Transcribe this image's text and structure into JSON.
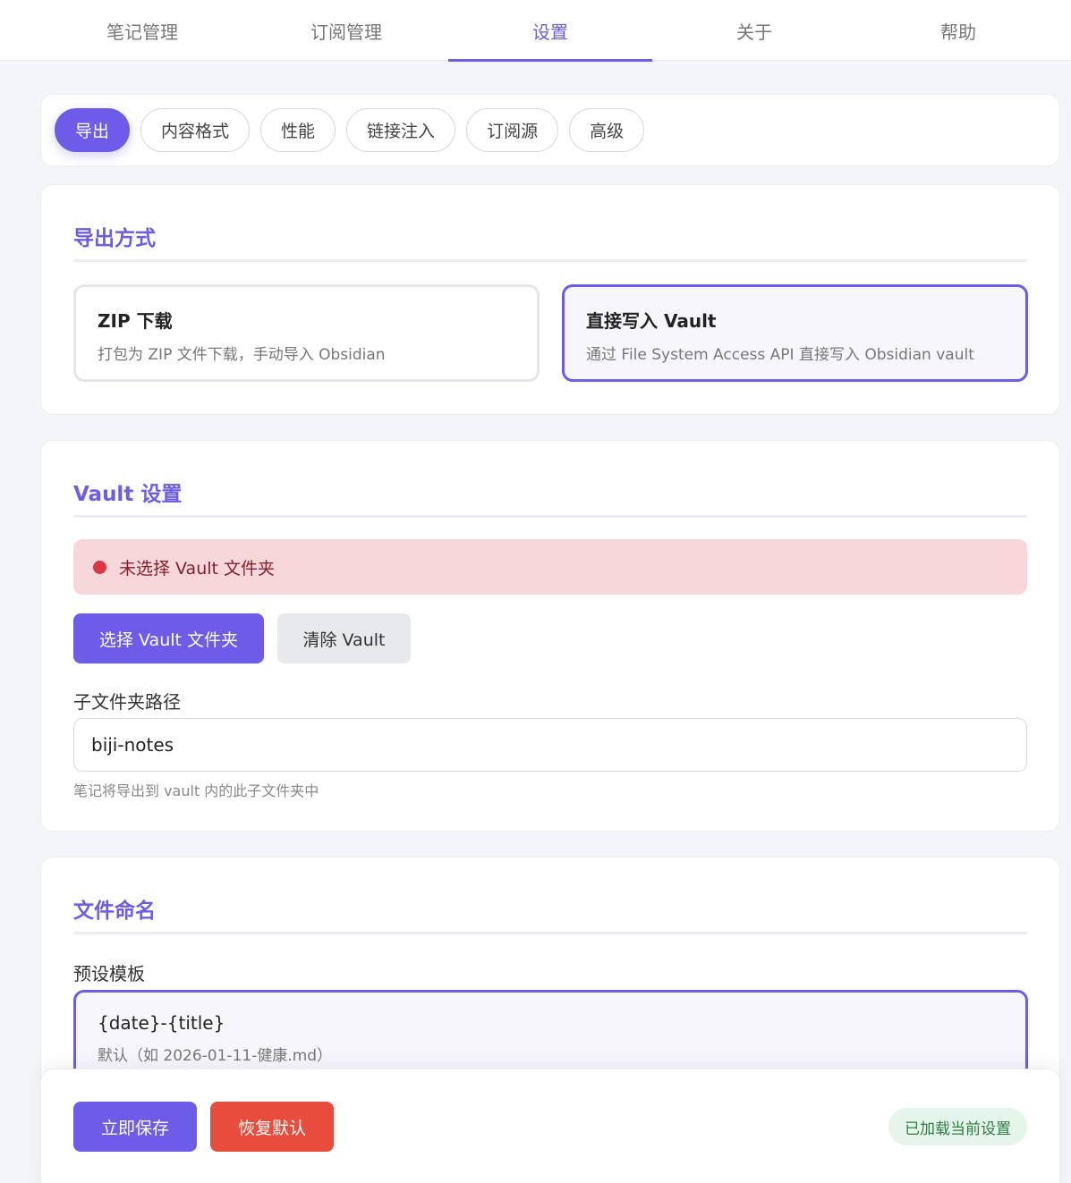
{
  "topnav": {
    "tabs": [
      {
        "label": "笔记管理"
      },
      {
        "label": "订阅管理"
      },
      {
        "label": "设置"
      },
      {
        "label": "关于"
      },
      {
        "label": "帮助"
      }
    ],
    "active_index": 2
  },
  "subtabs": {
    "items": [
      {
        "label": "导出"
      },
      {
        "label": "内容格式"
      },
      {
        "label": "性能"
      },
      {
        "label": "链接注入"
      },
      {
        "label": "订阅源"
      },
      {
        "label": "高级"
      }
    ],
    "active_index": 0
  },
  "export_method": {
    "title": "导出方式",
    "options": [
      {
        "title": "ZIP 下载",
        "desc": "打包为 ZIP 文件下载，手动导入 Obsidian"
      },
      {
        "title": "直接写入 Vault",
        "desc": "通过 File System Access API 直接写入 Obsidian vault"
      }
    ],
    "selected_index": 1
  },
  "vault": {
    "title": "Vault 设置",
    "alert": "未选择 Vault 文件夹",
    "choose_button": "选择 Vault 文件夹",
    "clear_button": "清除 Vault",
    "subfolder_label": "子文件夹路径",
    "subfolder_value": "biji-notes",
    "subfolder_hint": "笔记将导出到 vault 内的此子文件夹中"
  },
  "naming": {
    "title": "文件命名",
    "preset_label": "预设模板",
    "preset_template": "{date}-{title}",
    "preset_desc": "默认（如 2026-01-11-健康.md）"
  },
  "footer": {
    "save_button": "立即保存",
    "reset_button": "恢复默认",
    "status": "已加载当前设置"
  },
  "colors": {
    "accent": "#6c5ce7",
    "danger": "#e74c3c",
    "success_bg": "#e6f5ea"
  }
}
